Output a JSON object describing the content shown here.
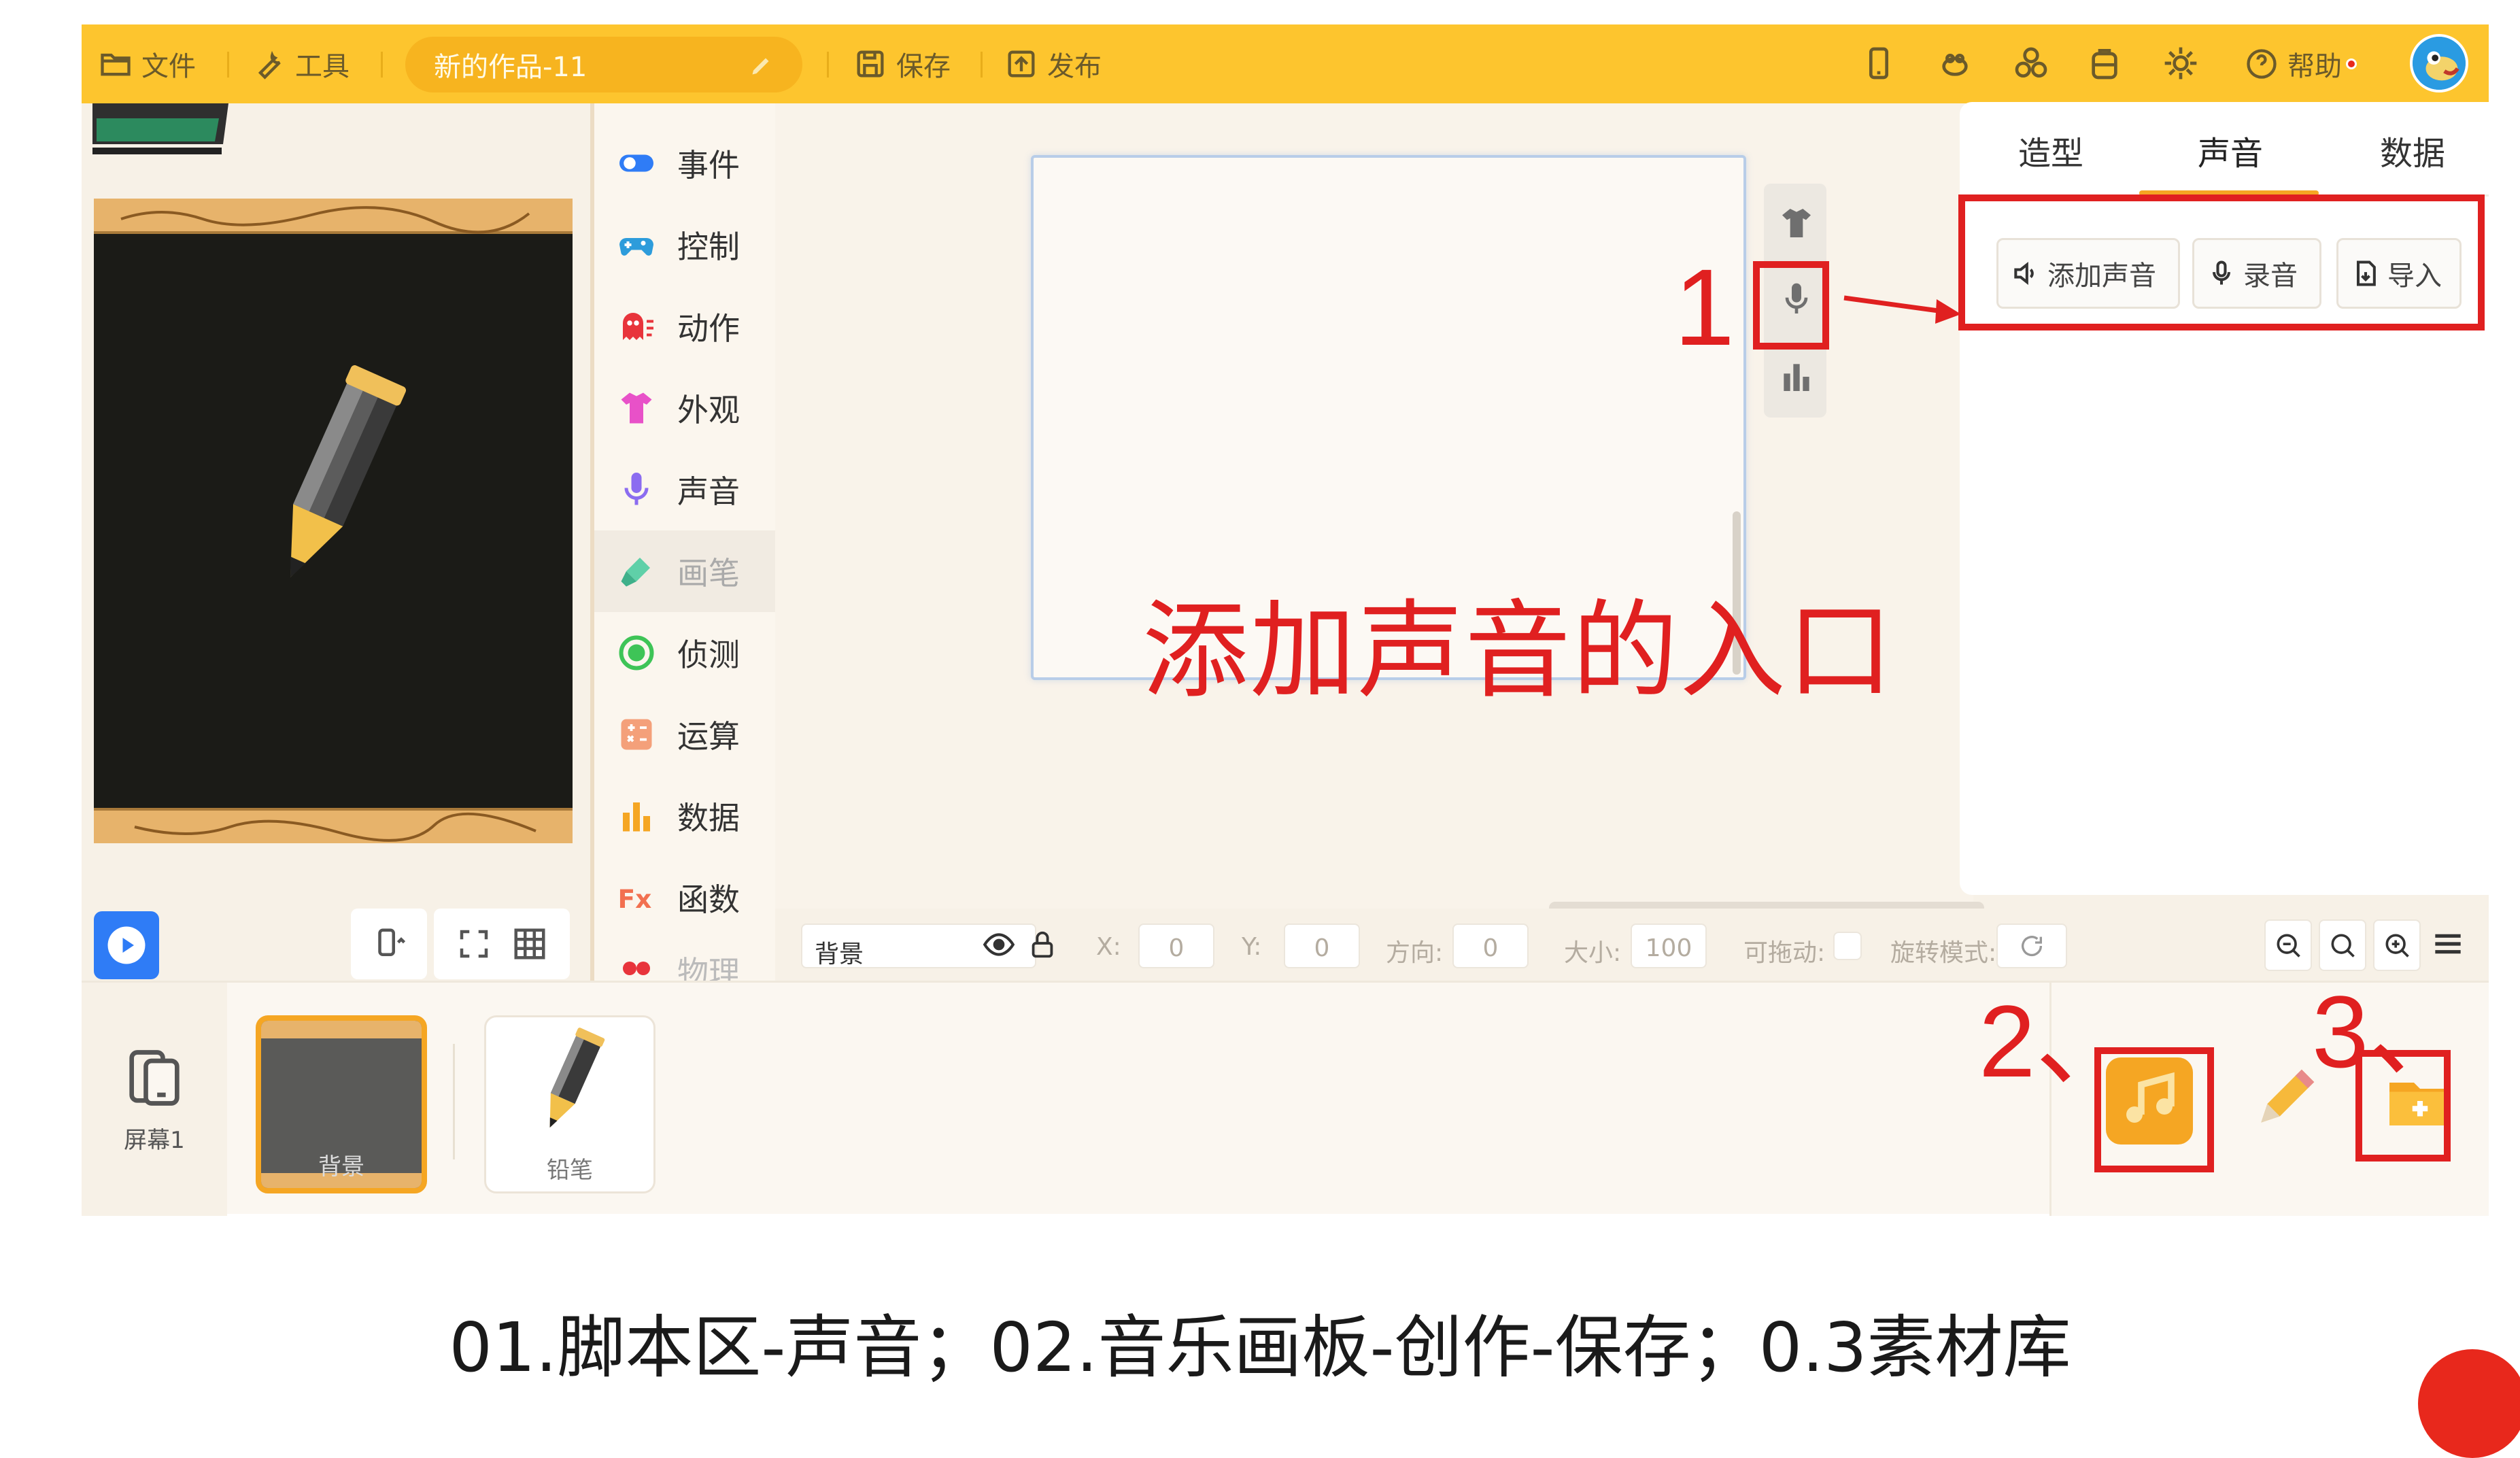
{
  "header": {
    "file_label": "文件",
    "tools_label": "工具",
    "project_title": "新的作品-11",
    "save_label": "保存",
    "publish_label": "发布",
    "help_label": "帮助"
  },
  "categories": [
    "事件",
    "控制",
    "动作",
    "外观",
    "声音",
    "画笔",
    "侦测",
    "运算",
    "数据",
    "函数",
    "物理"
  ],
  "right_panel": {
    "tabs": [
      "造型",
      "声音",
      "数据"
    ],
    "active_tab": "声音",
    "buttons": {
      "add_sound": "添加声音",
      "record": "录音",
      "import": "导入"
    }
  },
  "popup_label": "添加声音的入口",
  "annotations": {
    "n1": "1",
    "n2": "2、",
    "n3": "3、"
  },
  "property_bar": {
    "sprite_name": "背景",
    "x_label": "X:",
    "x_value": "0",
    "y_label": "Y:",
    "y_value": "0",
    "direction_label": "方向:",
    "direction_value": "0",
    "size_label": "大小:",
    "size_value": "100",
    "draggable_label": "可拖动:",
    "rotation_label": "旋转模式:"
  },
  "bottom": {
    "screen_label": "屏幕1",
    "sprites": [
      "背景",
      "铅笔"
    ]
  },
  "caption": "01.脚本区-声音；02.音乐画板-创作-保存；0.3素材库",
  "colors": {
    "brand_yellow": "#fdc52e",
    "accent_orange": "#f5a623",
    "annotation_red": "#e02020",
    "play_blue": "#2f7cf6"
  }
}
